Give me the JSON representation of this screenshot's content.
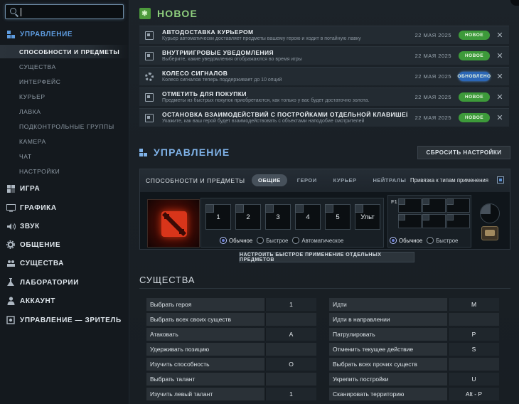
{
  "sidebar": {
    "search": {
      "value": ""
    },
    "sections": [
      {
        "label": "Управление",
        "icon": "grid-icon",
        "active": true
      },
      {
        "label": "Игра",
        "icon": "game-icon"
      },
      {
        "label": "Графика",
        "icon": "monitor-icon"
      },
      {
        "label": "Звук",
        "icon": "speaker-icon"
      },
      {
        "label": "Общение",
        "icon": "gear-icon"
      },
      {
        "label": "Существа",
        "icon": "units-icon"
      },
      {
        "label": "Лаборатории",
        "icon": "flask-icon"
      },
      {
        "label": "Аккаунт",
        "icon": "person-icon"
      },
      {
        "label": "Управление — зритель",
        "icon": "eye-icon"
      }
    ],
    "subitems": [
      "Способности и предметы",
      "Существа",
      "Интерфейс",
      "Курьер",
      "Лавка",
      "Подконтрольные группы",
      "Камера",
      "Чат",
      "Настройки"
    ]
  },
  "whats_new": {
    "title": "Новое",
    "items": [
      {
        "title": "Автодоставка курьером",
        "desc": "Курьер автоматически доставляет предметы вашему герою и ходит в потайную лавку",
        "date": "22 мая 2025",
        "badge": "Новое",
        "badge_color": "#3d9a3a",
        "icon": "toggle-icon"
      },
      {
        "title": "Внутриигровые уведомления",
        "desc": "Выберите, какие уведомления отображаются во время игры",
        "date": "22 мая 2025",
        "badge": "Новое",
        "badge_color": "#3d9a3a",
        "icon": "toggle-icon"
      },
      {
        "title": "Колесо сигналов",
        "desc": "Колесо сигналов теперь поддерживает до 10 опций",
        "date": "22 мая 2025",
        "badge": "Обновлено",
        "badge_color": "#2b66b6",
        "icon": "gear-icon"
      },
      {
        "title": "Отметить для покупки",
        "desc": "Предметы из быстрых покупок приобретаются, как только у вас будет достаточно золота.",
        "date": "22 мая 2025",
        "badge": "Новое",
        "badge_color": "#3d9a3a",
        "icon": "toggle-icon"
      },
      {
        "title": "Остановка взаимодействий с постройками отдельной клавишей",
        "desc": "Укажите, как ваш герой будет взаимодействовать с объектами наподобие смотрителей",
        "date": "22 мая 2025",
        "badge": "Новое",
        "badge_color": "#3d9a3a",
        "icon": "toggle-icon"
      }
    ]
  },
  "controls": {
    "title": "Управление",
    "reset_label": "Сбросить настройки",
    "abilities_label": "Способности и предметы",
    "tabs": [
      "Общие",
      "Герои",
      "Курьер",
      "Нейтралы"
    ],
    "bind_label": "Привязка к типам применения",
    "slots": [
      "1",
      "2",
      "3",
      "4",
      "5",
      "Ульт"
    ],
    "cast_modes": [
      "Обычное",
      "Быстрое",
      "Автоматическое"
    ],
    "inventory_key": "F1",
    "inventory_modes": [
      "Обычное",
      "Быстрое"
    ],
    "quickcast_button": "Настроить быстрое применение отдельных предметов"
  },
  "units": {
    "title": "Существа",
    "left": [
      {
        "label": "Выбрать героя",
        "key": "1"
      },
      {
        "label": "Выбрать всех своих существ",
        "key": ""
      },
      {
        "label": "Атаковать",
        "key": "A"
      },
      {
        "label": "Удерживать позицию",
        "key": ""
      },
      {
        "label": "Изучить способность",
        "key": "O"
      },
      {
        "label": "Выбрать талант",
        "key": ""
      },
      {
        "label": "Изучить левый талант",
        "key": "1"
      }
    ],
    "right": [
      {
        "label": "Идти",
        "key": "M"
      },
      {
        "label": "Идти в направлении",
        "key": ""
      },
      {
        "label": "Патрулировать",
        "key": "P"
      },
      {
        "label": "Отменить текущее действие",
        "key": "S"
      },
      {
        "label": "Выбрать всех прочих существ",
        "key": ""
      },
      {
        "label": "Укрепить постройки",
        "key": "U"
      },
      {
        "label": "Сканировать территорию",
        "key": "Alt - P"
      }
    ]
  }
}
